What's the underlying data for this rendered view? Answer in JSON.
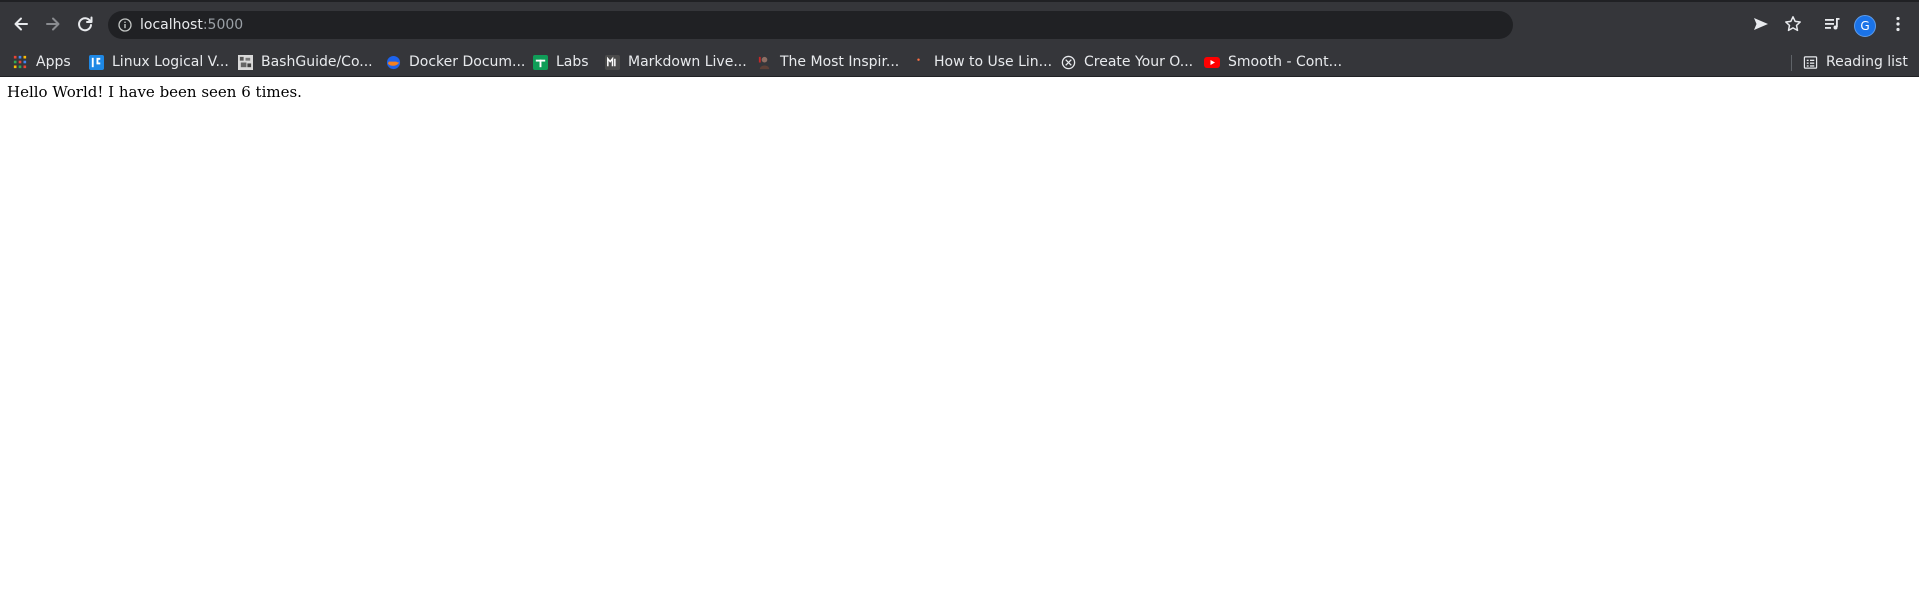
{
  "browser": {
    "url_host": "localhost",
    "url_port": ":5000",
    "profile_initial": "G"
  },
  "bookmarks": [
    {
      "label": "Apps",
      "icon": "apps-grid-icon"
    },
    {
      "label": "Linux Logical V...",
      "icon": "linux-logical-favicon"
    },
    {
      "label": "BashGuide/Co...",
      "icon": "bashguide-favicon"
    },
    {
      "label": "Docker Docum...",
      "icon": "docker-favicon"
    },
    {
      "label": "Labs",
      "icon": "labs-favicon"
    },
    {
      "label": "Markdown Live...",
      "icon": "markdown-favicon"
    },
    {
      "label": "The Most Inspir...",
      "icon": "inspire-favicon"
    },
    {
      "label": "How to Use Lin...",
      "icon": "howto-favicon"
    },
    {
      "label": "Create Your O...",
      "icon": "create-favicon"
    },
    {
      "label": "Smooth - Cont...",
      "icon": "youtube-favicon"
    }
  ],
  "reading_list_label": "Reading list",
  "page": {
    "message": "Hello World! I have been seen 6 times."
  },
  "colors": {
    "toolbar_bg": "#35363a",
    "omnibox_bg": "#202124",
    "avatar_bg": "#1a73e8",
    "page_bg": "#ffffff"
  }
}
